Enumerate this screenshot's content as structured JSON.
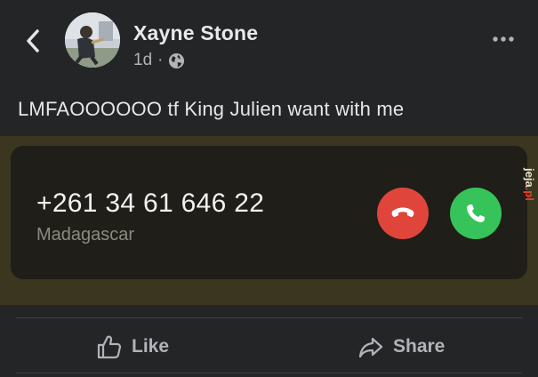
{
  "post": {
    "author": "Xayne Stone",
    "time": "1d",
    "separator": "·",
    "text": "LMFAOOOOOO tf King Julien want with me"
  },
  "call": {
    "number": "+261 34 61 646 22",
    "location": "Madagascar"
  },
  "watermark": {
    "brand": "jeja",
    "tld": ".pl"
  },
  "actions": {
    "like_label": "Like",
    "share_label": "Share"
  },
  "colors": {
    "background": "#242526",
    "decline": "#e0453c",
    "accept": "#36c45a",
    "card": "#1f1e18",
    "image_bg": "#3a3620"
  },
  "icons": [
    "back-chevron-icon",
    "globe-icon",
    "more-options-icon",
    "decline-call-icon",
    "accept-call-icon",
    "thumbs-up-icon",
    "share-arrow-icon"
  ]
}
